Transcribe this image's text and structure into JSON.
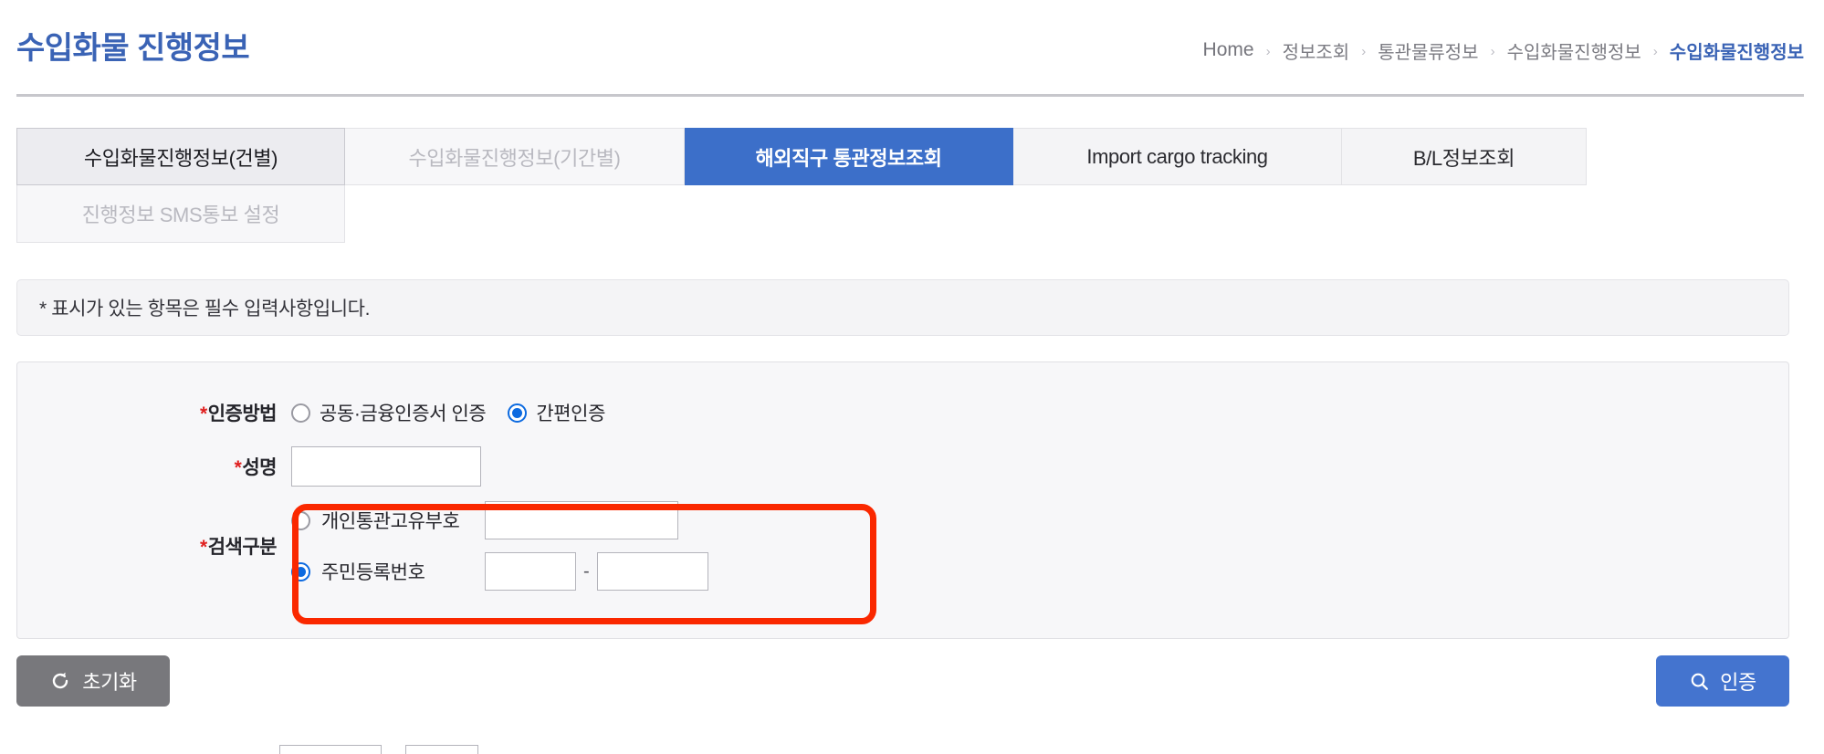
{
  "header": {
    "title": "수입화물 진행정보",
    "breadcrumb": [
      {
        "label": "Home",
        "current": false
      },
      {
        "label": "정보조회",
        "current": false
      },
      {
        "label": "통관물류정보",
        "current": false
      },
      {
        "label": "수입화물진행정보",
        "current": false
      },
      {
        "label": "수입화물진행정보",
        "current": true
      }
    ],
    "separator": "›"
  },
  "tabs": {
    "row1": [
      {
        "label": "수입화물진행정보(건별)",
        "state": "selected"
      },
      {
        "label": "수입화물진행정보(기간별)",
        "state": "dim"
      },
      {
        "label": "해외직구 통관정보조회",
        "state": "active"
      },
      {
        "label": "Import cargo tracking",
        "state": "normal"
      },
      {
        "label": "B/L정보조회",
        "state": "normal"
      }
    ],
    "row2": [
      {
        "label": "진행정보 SMS통보 설정",
        "state": "dim"
      }
    ]
  },
  "notice": {
    "text": "* 표시가 있는 항목은 필수 입력사항입니다."
  },
  "form": {
    "auth_method": {
      "label": "인증방법",
      "required_mark": "*",
      "options": [
        {
          "label": "공동·금융인증서 인증",
          "checked": false
        },
        {
          "label": "간편인증",
          "checked": true
        }
      ]
    },
    "name": {
      "label": "성명",
      "required_mark": "*",
      "value": "",
      "placeholder": ""
    },
    "search_type": {
      "label": "검색구분",
      "required_mark": "*",
      "options": [
        {
          "label": "개인통관고유부호",
          "checked": false
        },
        {
          "label": "주민등록번호",
          "checked": true
        }
      ],
      "personal_code_value": "",
      "ssn_front_value": "",
      "ssn_back_value": "",
      "ssn_separator": "-"
    }
  },
  "actions": {
    "reset_label": "초기화",
    "reset_icon": "refresh-icon",
    "auth_label": "인증",
    "auth_icon": "search-icon"
  },
  "colors": {
    "title_blue": "#3a63b5",
    "tab_active": "#3c6fc9",
    "required_red": "#e02020",
    "highlight_red": "#fa2800",
    "radio_blue": "#0c6ae0",
    "button_gray": "#78787c",
    "button_blue": "#4474cf"
  }
}
